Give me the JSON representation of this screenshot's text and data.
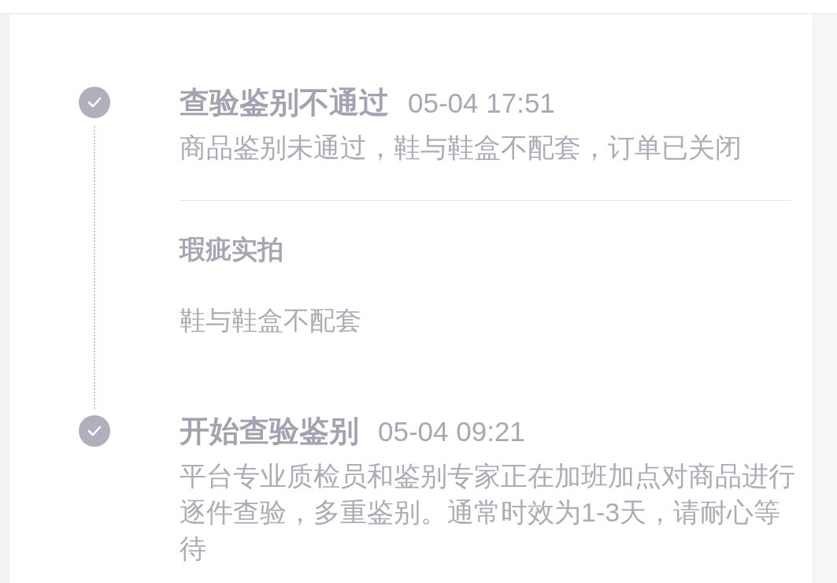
{
  "events": [
    {
      "title": "查验鉴别不通过",
      "time": "05-04 17:51",
      "completed": true,
      "description": "商品鉴别未通过，鞋与鞋盒不配套，订单已关闭",
      "details": {
        "heading": "瑕疵实拍",
        "text": "鞋与鞋盒不配套"
      }
    },
    {
      "title": "开始查验鉴别",
      "time": "05-04 09:21",
      "completed": true,
      "description": "平台专业质检员和鉴别专家正在加班加点对商品进行逐件查验，多重鉴别。通常时效为1-3天，请耐心等待"
    }
  ]
}
